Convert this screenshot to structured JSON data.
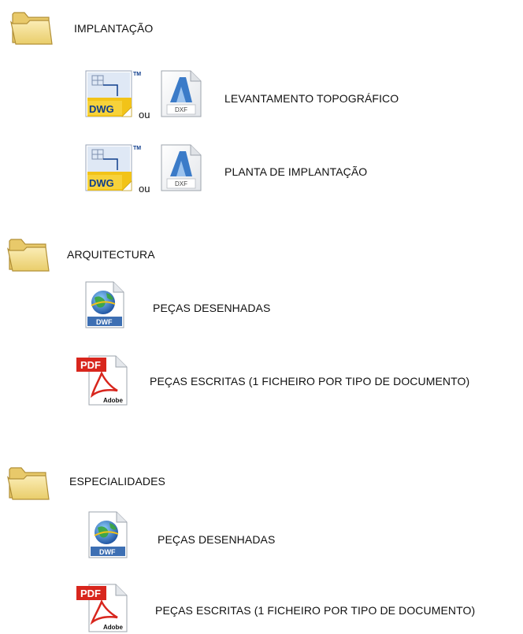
{
  "implantacao": {
    "title": "IMPLANTAÇÃO",
    "levantamento": {
      "label": "LEVANTAMENTO TOPOGRÁFICO",
      "or": "ou",
      "dwg_text": "DWG",
      "dxf_text": "DXF",
      "tm_text": "TM"
    },
    "planta": {
      "label": "PLANTA DE IMPLANTAÇÃO",
      "or": "ou",
      "dwg_text": "DWG",
      "dxf_text": "DXF",
      "tm_text": "TM"
    }
  },
  "arquitectura": {
    "title": "ARQUITECTURA",
    "desenhadas": {
      "label": "PEÇAS DESENHADAS",
      "dwf_text": "DWF"
    },
    "escritas": {
      "label": "PEÇAS ESCRITAS (1 FICHEIRO POR TIPO DE DOCUMENTO)",
      "pdf_text": "PDF",
      "adobe_text": "Adobe"
    }
  },
  "especialidades": {
    "title": "ESPECIALIDADES",
    "desenhadas": {
      "label": "PEÇAS DESENHADAS",
      "dwf_text": "DWF"
    },
    "escritas": {
      "label": "PEÇAS ESCRITAS (1 FICHEIRO POR TIPO DE DOCUMENTO)",
      "pdf_text": "PDF",
      "adobe_text": "Adobe"
    }
  },
  "icons": {
    "folder": "folder-icon",
    "dwg": "dwg-file-icon",
    "dxf": "dxf-file-icon",
    "dwf": "dwf-file-icon",
    "pdf": "pdf-file-icon"
  },
  "colors": {
    "folder_fill": "#f3dd8a",
    "folder_stroke": "#b29037",
    "dwg_yellow": "#f2c318",
    "dwg_blue": "#0f3d8c",
    "dxf_blue": "#3b7bc8",
    "pdf_red": "#d8261d",
    "dwf_globe": "#2a6fc2"
  }
}
